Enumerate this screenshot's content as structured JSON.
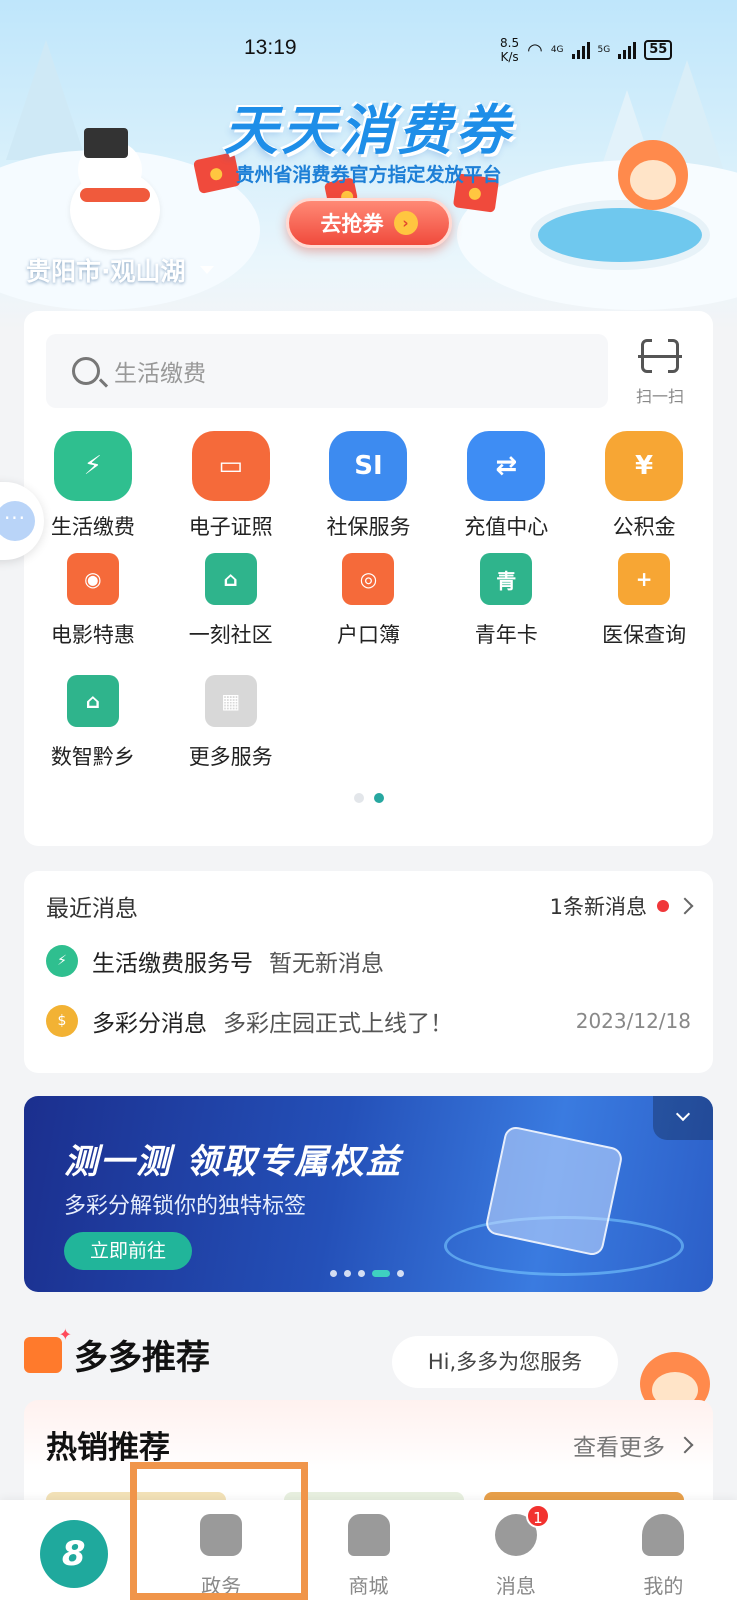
{
  "status_bar": {
    "time": "13:19",
    "net_speed_value": "8.5",
    "net_speed_unit": "K/s",
    "network_1": "4G",
    "network_2": "5G",
    "battery": "55"
  },
  "hero": {
    "title": "天天消费券",
    "subtitle": "贵州省消费券官方指定发放平台",
    "button_label": "去抢券",
    "location": "贵阳市·观山湖"
  },
  "search": {
    "placeholder": "生活缴费",
    "scan_label": "扫一扫"
  },
  "services": {
    "row1": [
      {
        "label": "生活缴费",
        "icon": "lightning-drop-icon",
        "color": "#2fbf8f",
        "glyph": "⚡"
      },
      {
        "label": "电子证照",
        "icon": "id-card-icon",
        "color": "#f56a3a",
        "glyph": "▭"
      },
      {
        "label": "社保服务",
        "icon": "si-icon",
        "color": "#3d8bf0",
        "glyph": "SI"
      },
      {
        "label": "充值中心",
        "icon": "phone-recharge-icon",
        "color": "#3e8df4",
        "glyph": "⇄"
      },
      {
        "label": "公积金",
        "icon": "house-fund-icon",
        "color": "#f7a634",
        "glyph": "¥"
      }
    ],
    "row2": [
      {
        "label": "电影特惠",
        "icon": "film-reel-icon",
        "color": "#f56a3a",
        "glyph": "◉"
      },
      {
        "label": "一刻社区",
        "icon": "community-house-icon",
        "color": "#2fb48c",
        "glyph": "⌂"
      },
      {
        "label": "户口簿",
        "icon": "household-register-icon",
        "color": "#f56a3a",
        "glyph": "◎"
      },
      {
        "label": "青年卡",
        "icon": "youth-card-icon",
        "color": "#2fb48c",
        "glyph": "青"
      },
      {
        "label": "医保查询",
        "icon": "medical-search-icon",
        "color": "#f7a634",
        "glyph": "+"
      }
    ],
    "row3": [
      {
        "label": "数智黔乡",
        "icon": "pavilion-icon",
        "color": "#2fb48c",
        "glyph": "⌂"
      },
      {
        "label": "更多服务",
        "icon": "more-grid-icon",
        "color": "#d8d8d8",
        "glyph": "▦"
      }
    ]
  },
  "messages": {
    "title": "最近消息",
    "new_count": "1条新消息",
    "items": [
      {
        "from": "生活缴费服务号",
        "text": "暂无新消息",
        "date": ""
      },
      {
        "from": "多彩分消息",
        "text": "多彩庄园正式上线了！",
        "date": "2023/12/18"
      }
    ]
  },
  "banner": {
    "title": "测一测  领取专属权益",
    "subtitle": "多彩分解锁你的独特标签",
    "button_label": "立即前往"
  },
  "recommend": {
    "title": "多多推荐",
    "greeting": "Hi,多多为您服务",
    "hot_title": "热销推荐",
    "see_more": "查看更多"
  },
  "tabbar": {
    "items": [
      {
        "label": "",
        "icon": "home-logo-icon"
      },
      {
        "label": "政务",
        "icon": "gov-affairs-icon"
      },
      {
        "label": "商城",
        "icon": "mall-store-icon"
      },
      {
        "label": "消息",
        "icon": "message-bubble-icon",
        "badge": "1"
      },
      {
        "label": "我的",
        "icon": "profile-icon"
      }
    ]
  },
  "colors": {
    "accent": "#27a7a0",
    "highlight_box": "#f0954a",
    "badge_red": "#f2322f"
  }
}
